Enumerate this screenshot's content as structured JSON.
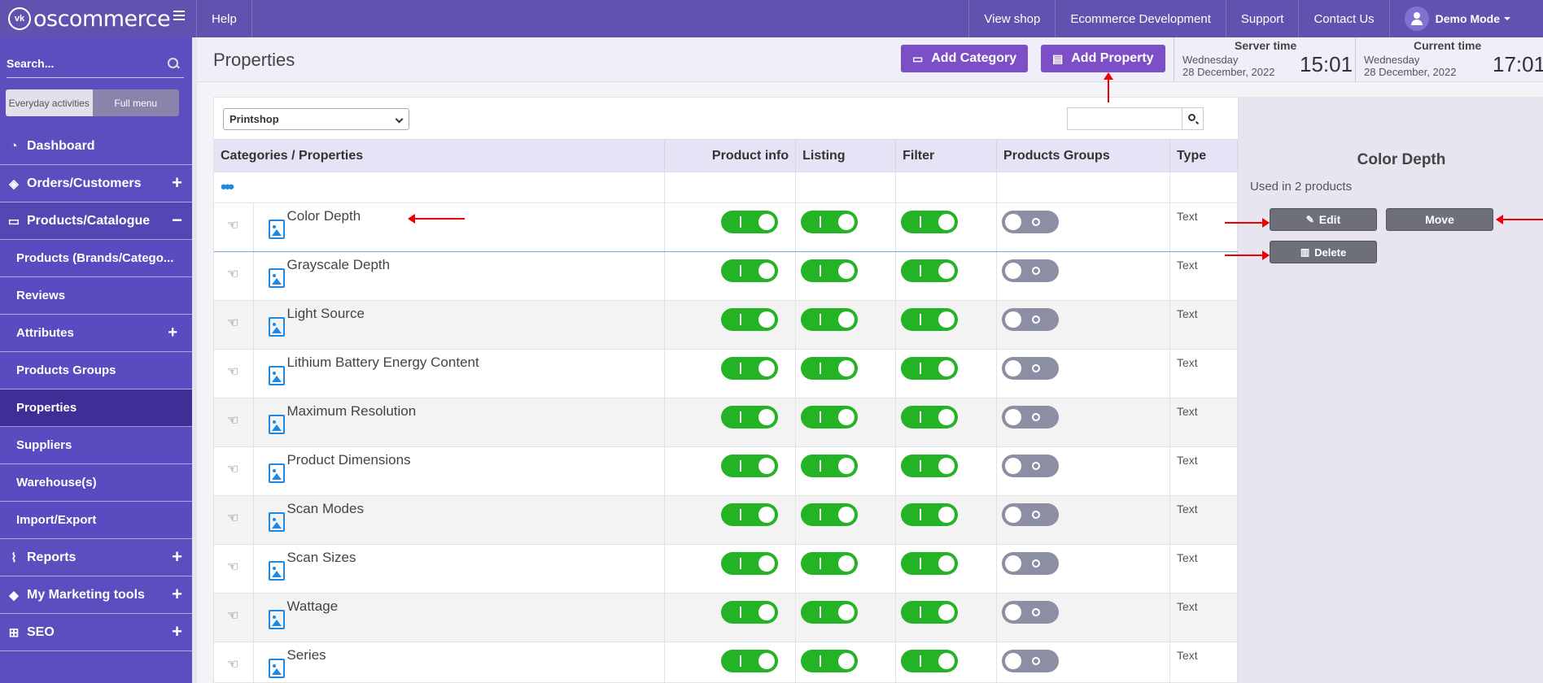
{
  "topbar": {
    "brand": "oscommerce",
    "logo_mark": "vk",
    "help": "Help",
    "links": [
      "View shop",
      "Ecommerce Development",
      "Support",
      "Contact Us"
    ],
    "user": "Demo Mode"
  },
  "sidebar": {
    "search_placeholder": "Search...",
    "mode_everyday": "Everyday activities",
    "mode_full": "Full menu",
    "items": [
      {
        "label": "Dashboard",
        "icon": "dashboard-icon"
      },
      {
        "label": "Orders/Customers",
        "icon": "layers-icon"
      },
      {
        "label": "Products/Catalogue",
        "icon": "folder-icon"
      }
    ],
    "subitems": [
      {
        "label": "Products (Brands/Catego..."
      },
      {
        "label": "Reviews"
      },
      {
        "label": "Attributes"
      },
      {
        "label": "Products Groups"
      },
      {
        "label": "Properties"
      },
      {
        "label": "Suppliers"
      },
      {
        "label": "Warehouse(s)"
      },
      {
        "label": "Import/Export"
      }
    ],
    "bottom_items": [
      {
        "label": "Reports",
        "icon": "chart-icon"
      },
      {
        "label": "My Marketing tools",
        "icon": "tag-icon"
      },
      {
        "label": "SEO",
        "icon": "sitemap-icon"
      }
    ]
  },
  "header": {
    "title": "Properties",
    "add_category": "Add Category",
    "add_property": "Add Property",
    "server_time_label": "Server time",
    "server_day": "Wednesday",
    "server_date": "28 December, 2022",
    "server_clock": "15:01",
    "current_time_label": "Current time",
    "current_day": "Wednesday",
    "current_date": "28 December, 2022",
    "current_clock": "17:01"
  },
  "table": {
    "category_filter": "Printshop",
    "columns": [
      "Categories / Properties",
      "Product info",
      "Listing",
      "Filter",
      "Products Groups",
      "Type"
    ],
    "rows": [
      {
        "name": "Color Depth",
        "product_info": true,
        "listing": true,
        "filter": true,
        "groups": false,
        "type": "Text"
      },
      {
        "name": "Grayscale Depth",
        "product_info": true,
        "listing": true,
        "filter": true,
        "groups": false,
        "type": "Text"
      },
      {
        "name": "Light Source",
        "product_info": true,
        "listing": true,
        "filter": true,
        "groups": false,
        "type": "Text"
      },
      {
        "name": "Lithium Battery Energy Content",
        "product_info": true,
        "listing": true,
        "filter": true,
        "groups": false,
        "type": "Text"
      },
      {
        "name": "Maximum Resolution",
        "product_info": true,
        "listing": true,
        "filter": true,
        "groups": false,
        "type": "Text"
      },
      {
        "name": "Product Dimensions",
        "product_info": true,
        "listing": true,
        "filter": true,
        "groups": false,
        "type": "Text"
      },
      {
        "name": "Scan Modes",
        "product_info": true,
        "listing": true,
        "filter": true,
        "groups": false,
        "type": "Text"
      },
      {
        "name": "Scan Sizes",
        "product_info": true,
        "listing": true,
        "filter": true,
        "groups": false,
        "type": "Text"
      },
      {
        "name": "Wattage",
        "product_info": true,
        "listing": true,
        "filter": true,
        "groups": false,
        "type": "Text"
      },
      {
        "name": "Series",
        "product_info": true,
        "listing": true,
        "filter": true,
        "groups": false,
        "type": "Text"
      }
    ]
  },
  "detail": {
    "title": "Color Depth",
    "used_in": "Used in 2 products",
    "edit": "Edit",
    "move": "Move",
    "delete": "Delete"
  },
  "colors": {
    "brand_purple": "#6152b0",
    "sidebar": "#5d4ec0",
    "toggle_on": "#24b324",
    "toggle_off": "#8c8fa3",
    "annotation": "#e00000"
  }
}
